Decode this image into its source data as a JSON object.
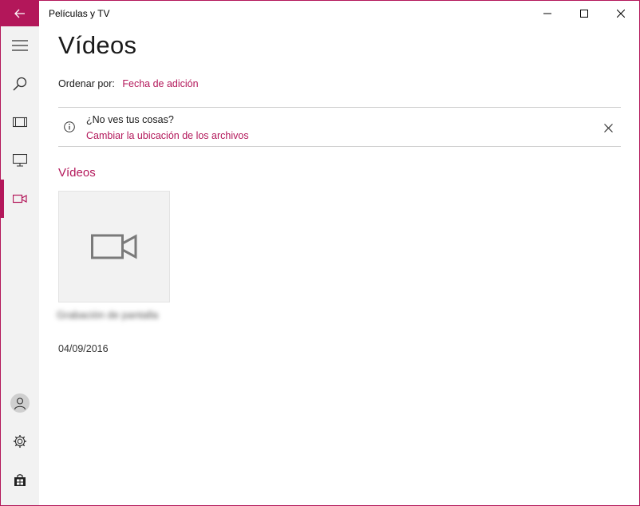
{
  "window": {
    "title": "Películas y TV",
    "accent_color": "#b3175a"
  },
  "nav": {
    "items": [
      {
        "icon": "hamburger-icon"
      },
      {
        "icon": "search-icon"
      },
      {
        "icon": "film-icon"
      },
      {
        "icon": "tv-icon"
      },
      {
        "icon": "video-camera-icon",
        "selected": true
      }
    ],
    "bottom": [
      {
        "icon": "account-icon"
      },
      {
        "icon": "gear-icon"
      },
      {
        "icon": "store-icon"
      }
    ]
  },
  "main": {
    "title": "Vídeos",
    "sort_label": "Ordenar por:",
    "sort_value": "Fecha de adición",
    "info": {
      "title": "¿No ves tus cosas?",
      "link": "Cambiar la ubicación de los archivos"
    },
    "section_title": "Vídeos",
    "items": [
      {
        "name": "Grabación de pantalla",
        "date": "04/09/2016"
      }
    ]
  }
}
